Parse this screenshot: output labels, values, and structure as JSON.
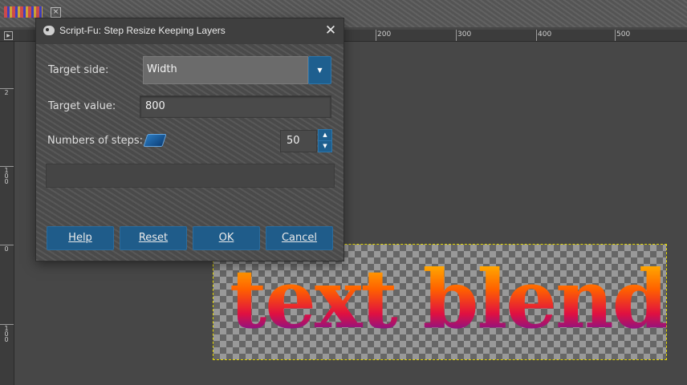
{
  "window": {
    "tab_close_glyph": "×"
  },
  "rulers": {
    "horizontal_labels": [
      "200",
      "300",
      "400",
      "500"
    ],
    "vertical_labels": [
      "2",
      "1 0 0",
      "0",
      "1 0 0"
    ]
  },
  "canvas": {
    "artwork_text": "text blend"
  },
  "dialog": {
    "title": "Script-Fu: Step Resize Keeping Layers",
    "close_glyph": "✕",
    "fields": {
      "target_side": {
        "label": "Target side:",
        "value": "Width"
      },
      "target_value": {
        "label": "Target value:",
        "value": "800"
      },
      "steps": {
        "label": "Numbers of steps:",
        "value": "50"
      }
    },
    "buttons": {
      "help": "Help",
      "reset": "Reset",
      "ok": "OK",
      "cancel": "Cancel"
    }
  },
  "colors": {
    "accent": "#1f5c8a",
    "canvas_bg": "#474747",
    "selection_outline": "#e6d800"
  }
}
